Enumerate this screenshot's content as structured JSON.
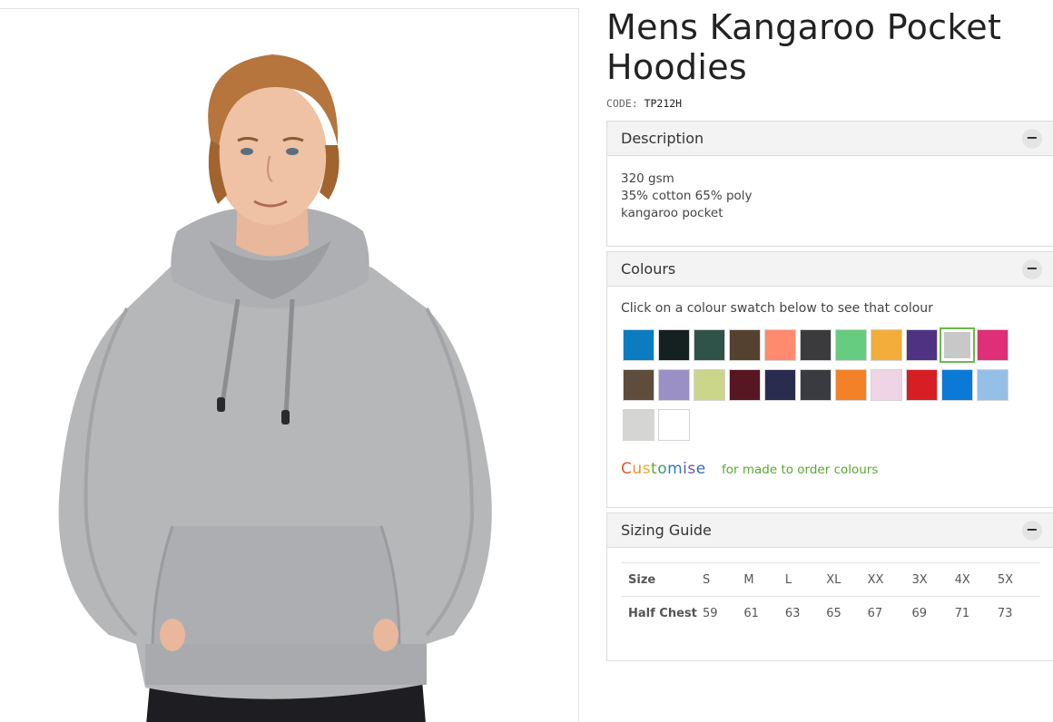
{
  "product": {
    "title": "Mens Kangaroo Pocket Hoodies",
    "code_label": "CODE:",
    "code_value": "TP212H"
  },
  "description": {
    "header": "Description",
    "toggle": "−",
    "lines": [
      "320 gsm",
      "35% cotton 65% poly",
      "kangaroo pocket"
    ]
  },
  "colours": {
    "header": "Colours",
    "toggle": "−",
    "intro": "Click on a colour swatch below to see that colour",
    "swatches": [
      "#0b7cbf",
      "#152020",
      "#2f5249",
      "#55412f",
      "#ff8a6e",
      "#3b3a3d",
      "#66cc7f",
      "#f2ad3b",
      "#503283",
      "#c8c8c8",
      "#de2f78",
      "#5e4c3c",
      "#9b90c5",
      "#ccd68a",
      "#561622",
      "#2a2c4f",
      "#3a3a41",
      "#f38128",
      "#efd4e6",
      "#d71e25",
      "#0a7ad6",
      "#96bfe8",
      "#d5d5d3",
      "#ffffff"
    ],
    "selected_index": 9,
    "customise_letters": [
      "C",
      "u",
      "s",
      "t",
      "o",
      "m",
      "i",
      "s",
      "e"
    ],
    "customise_colors": [
      "#e4572e",
      "#e4912e",
      "#e0b02c",
      "#6ba539",
      "#3c9e5e",
      "#2f7bbf",
      "#4a5fb8",
      "#7a4fb3",
      "#2f6fa8"
    ],
    "customise_note": "for made to order colours"
  },
  "sizing": {
    "header": "Sizing Guide",
    "toggle": "−",
    "rows": [
      {
        "label": "Size",
        "values": [
          "S",
          "M",
          "L",
          "XL",
          "XX",
          "3X",
          "4X",
          "5X"
        ]
      },
      {
        "label": "Half Chest",
        "values": [
          "59",
          "61",
          "63",
          "65",
          "67",
          "69",
          "71",
          "73"
        ]
      }
    ]
  }
}
